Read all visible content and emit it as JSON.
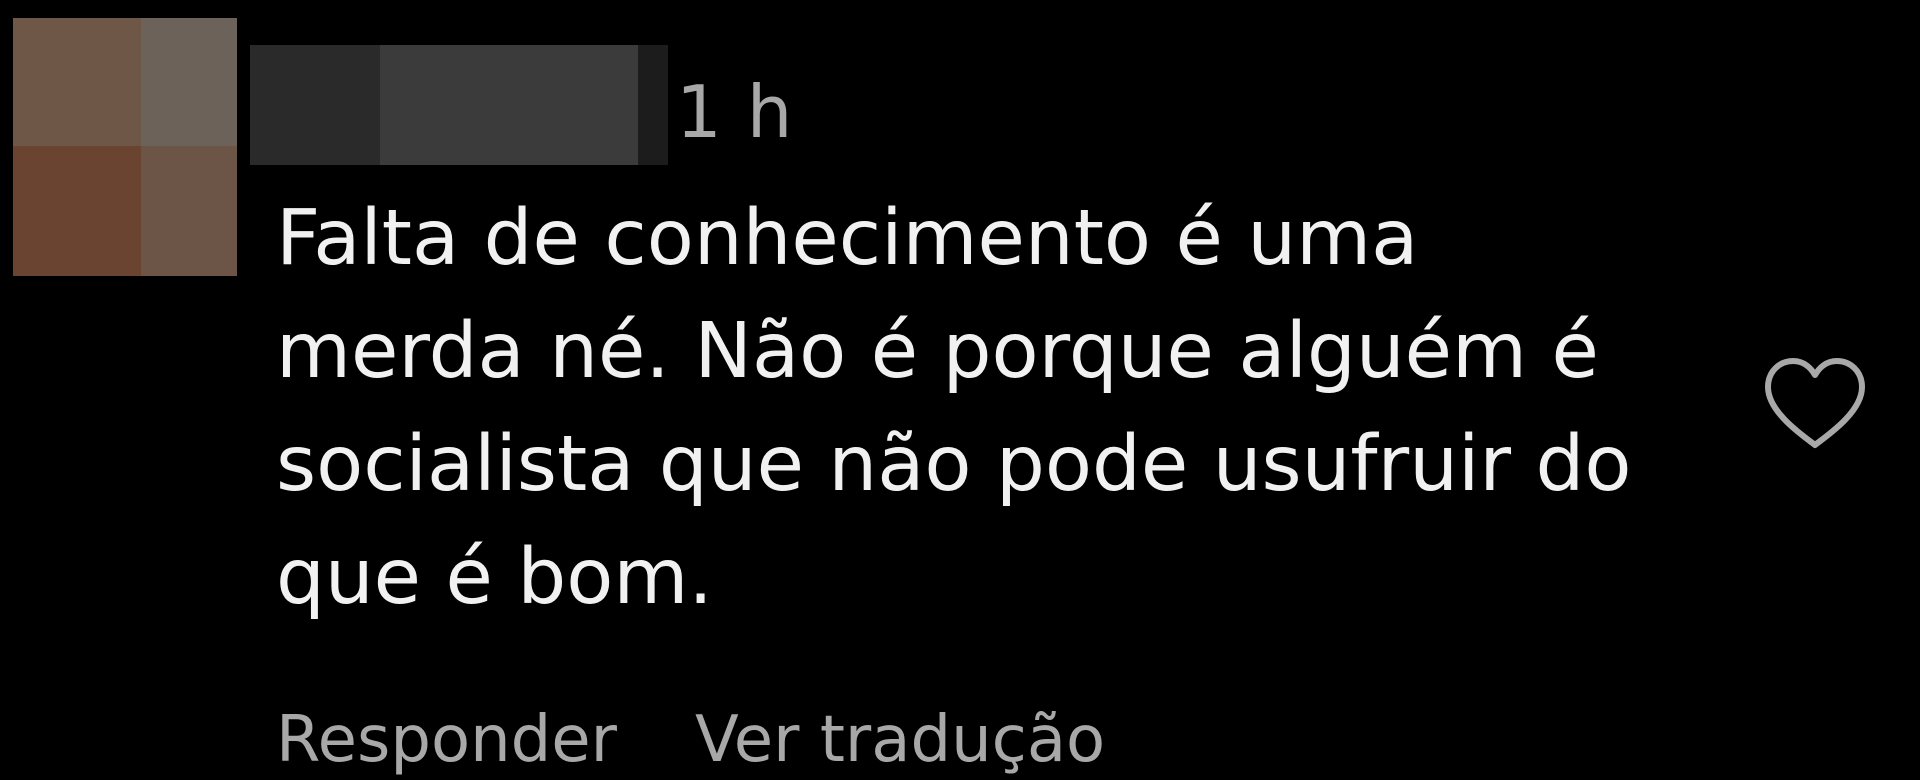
{
  "comment": {
    "timestamp": "1 h",
    "text": "Falta de conhecimento é uma\nmerda né. Não é porque alguém é\nsocialista que não pode usufruir do\nque é bom.",
    "actions": {
      "reply_label": "Responder",
      "translate_label": "Ver tradução"
    },
    "icons": {
      "like": "heart-outline-icon"
    }
  },
  "colors": {
    "background": "#000000",
    "primary_text": "#f1f1f1",
    "secondary_text": "#a8a8a8"
  }
}
